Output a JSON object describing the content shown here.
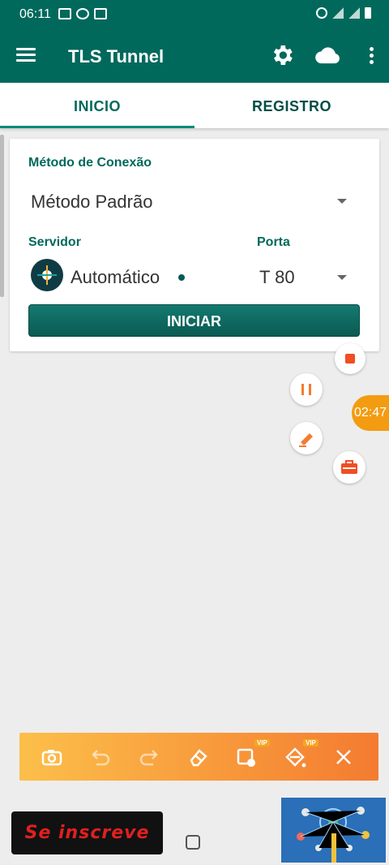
{
  "status_bar": {
    "time": "06:11"
  },
  "app_bar": {
    "title": "TLS Tunnel"
  },
  "tabs": [
    {
      "label": "INICIO",
      "active": true
    },
    {
      "label": "REGISTRO",
      "active": false
    }
  ],
  "connection": {
    "method_label": "Método de Conexão",
    "method_value": "Método Padrão",
    "server_label": "Servidor",
    "server_value": "Automático",
    "port_label": "Porta",
    "port_value": "T 80",
    "start_label": "INICIAR"
  },
  "recorder": {
    "timer": "02:47"
  },
  "toolbar": {
    "vip_label": "VIP"
  },
  "overlay": {
    "subscribe_text": "Se inscreve"
  },
  "colors": {
    "primary": "#00695c",
    "accent": "#f39c12"
  }
}
